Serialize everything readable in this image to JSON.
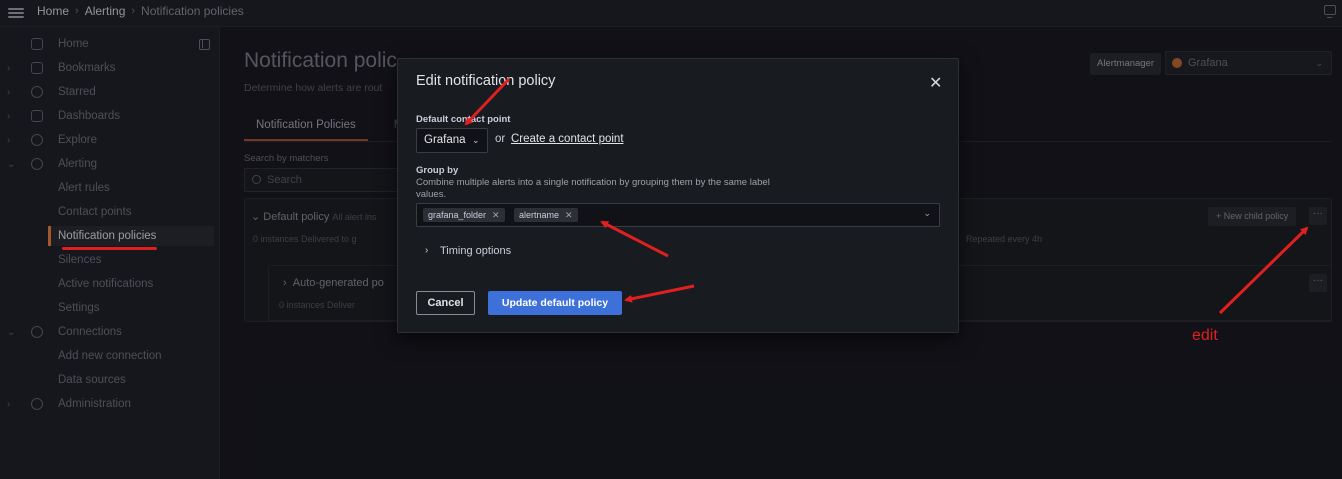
{
  "breadcrumb": [
    "Home",
    "Alerting",
    "Notification policies"
  ],
  "sidebar": {
    "items": [
      {
        "label": "Home",
        "icon": "home-icon"
      },
      {
        "label": "Bookmarks",
        "icon": "bookmark-icon"
      },
      {
        "label": "Starred",
        "icon": "star-icon"
      },
      {
        "label": "Dashboards",
        "icon": "dashboards-icon"
      },
      {
        "label": "Explore",
        "icon": "compass-icon"
      },
      {
        "label": "Alerting",
        "icon": "bell-icon"
      },
      {
        "label": "Alert rules"
      },
      {
        "label": "Contact points"
      },
      {
        "label": "Notification policies"
      },
      {
        "label": "Silences"
      },
      {
        "label": "Active notifications"
      },
      {
        "label": "Settings"
      },
      {
        "label": "Connections",
        "icon": "connections-icon"
      },
      {
        "label": "Add new connection"
      },
      {
        "label": "Data sources"
      },
      {
        "label": "Administration",
        "icon": "gear-icon"
      }
    ]
  },
  "page": {
    "title": "Notification polic",
    "subtitle": "Determine how alerts are rout",
    "alertmanager_label": "Alertmanager",
    "alertmanager_value": "Grafana",
    "tabs": [
      "Notification Policies",
      "Mu"
    ],
    "search_label": "Search by matchers",
    "search_placeholder": "Search",
    "default_policy_title": "Default policy",
    "default_policy_hint": "All alert ins",
    "default_policy_meta": "0 instances   Delivered to g",
    "default_policy_repeat": "Repeated every 4h",
    "new_child_label": "+ New child policy",
    "more_label": "···",
    "child_title": "Auto-generated po",
    "child_meta": "0 instances   Deliver"
  },
  "modal": {
    "title": "Edit notification policy",
    "close_glyph": "✕",
    "contact_point_label": "Default contact point",
    "contact_point_value": "Grafana",
    "or_text": "or",
    "create_link": "Create a contact point",
    "group_by_label": "Group by",
    "group_by_desc": "Combine multiple alerts into a single notification by grouping them by the same label values.",
    "group_by_chips": [
      "grafana_folder",
      "alertname"
    ],
    "timing_label": "Timing options",
    "cancel_label": "Cancel",
    "submit_label": "Update default policy"
  },
  "annotations": {
    "edit_label": "edit",
    "arrow_color": "#e02020"
  }
}
